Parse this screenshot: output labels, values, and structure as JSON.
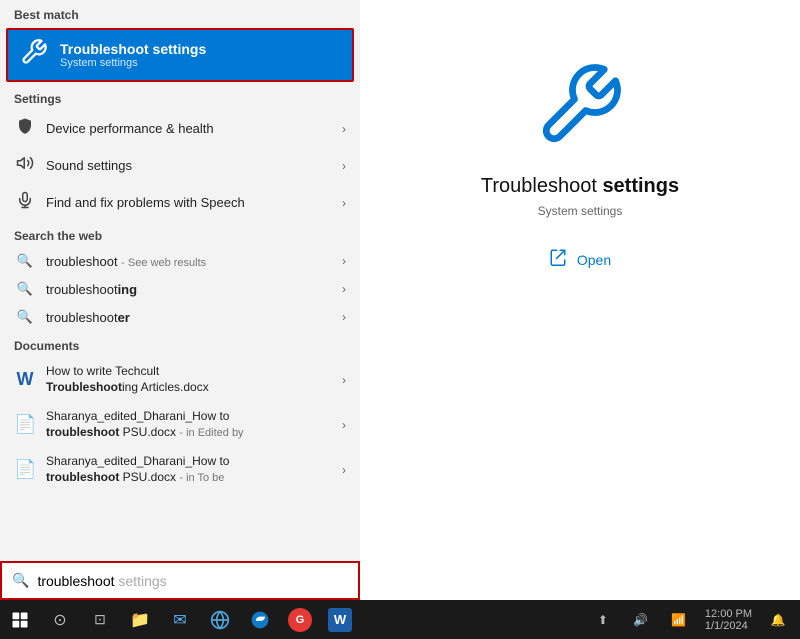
{
  "leftPanel": {
    "bestMatch": {
      "label": "Best match",
      "item": {
        "title": "Troubleshoot",
        "titleRest": " settings",
        "subtitle": "System settings"
      }
    },
    "settings": {
      "label": "Settings",
      "items": [
        {
          "icon": "🛡",
          "label": "Device performance & health"
        },
        {
          "icon": "🔊",
          "label": "Sound settings"
        },
        {
          "icon": "🎤",
          "label": "Find and fix problems with Speech"
        }
      ]
    },
    "searchWeb": {
      "label": "Search the web",
      "items": [
        {
          "label": "troubleshoot",
          "labelSuffix": " - See web results"
        },
        {
          "label": "troubleshoot",
          "labelBold": "ing"
        },
        {
          "label": "troubleshoot",
          "labelBold": "er"
        }
      ]
    },
    "documents": {
      "label": "Documents",
      "items": [
        {
          "title": "How to write Techcult",
          "titleBold": "Troubleshoot",
          "titleRest": "ing Articles.docx"
        },
        {
          "title": "Sharanya_edited_Dharani_How to",
          "titleBold": "troubleshoot",
          "titleRest": " PSU.docx",
          "sub": "- in Edited by"
        },
        {
          "title": "Sharanya_edited_Dharani_How to",
          "titleBold": "troubleshoot",
          "titleRest": " PSU.docx",
          "sub": "- in To be"
        }
      ]
    }
  },
  "rightPanel": {
    "title": "Troubleshoot",
    "titleBold": " settings",
    "subtitle": "System settings",
    "action": "Open"
  },
  "searchBar": {
    "typed": "troubleshoot",
    "placeholder": " settings"
  },
  "taskbar": {
    "appIcons": [
      "⊞",
      "⊡",
      "📁",
      "✉",
      "🌐",
      "🌍",
      "🔴",
      "W"
    ]
  }
}
